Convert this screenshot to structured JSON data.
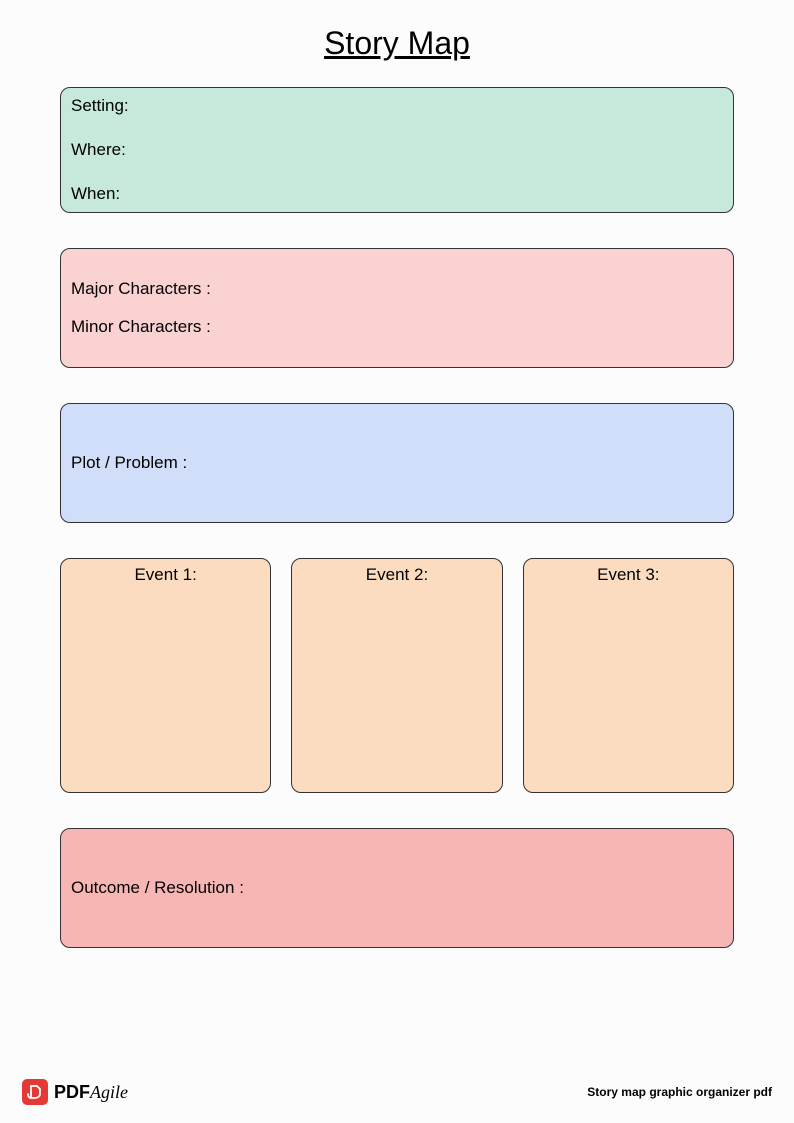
{
  "title": "Story Map",
  "setting": {
    "label1": "Setting:",
    "label2": "Where:",
    "label3": "When:"
  },
  "characters": {
    "major": "Major Characters :",
    "minor": "Minor Characters :"
  },
  "plot": {
    "label": "Plot / Problem :"
  },
  "events": [
    {
      "label": "Event 1:"
    },
    {
      "label": "Event 2:"
    },
    {
      "label": "Event 3:"
    }
  ],
  "outcome": {
    "label": "Outcome / Resolution :"
  },
  "footer": {
    "logo_pdf": "PDF",
    "logo_agile": "Agile",
    "right": "Story map graphic organizer pdf"
  }
}
